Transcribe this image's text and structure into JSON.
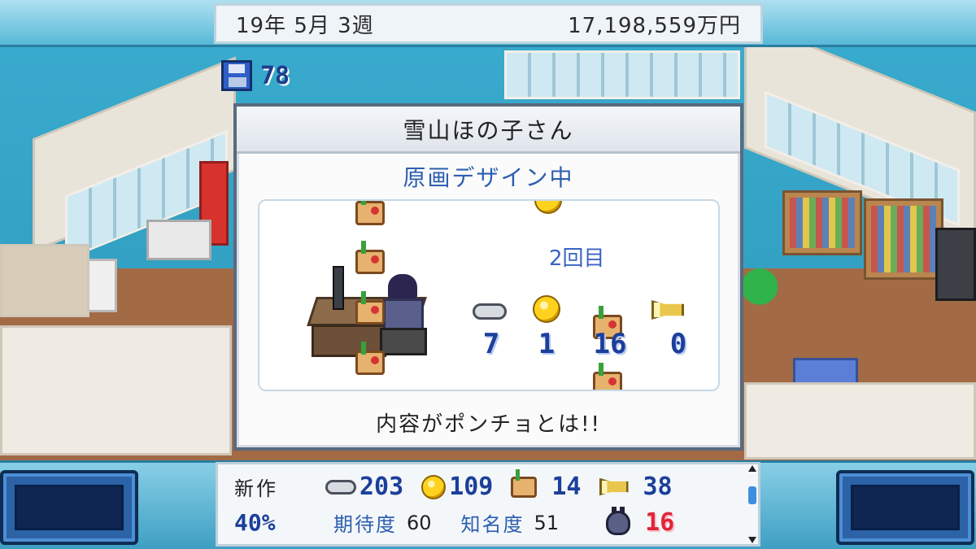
{
  "top_bar": {
    "date": "19年  5月  3週",
    "money": "17,198,559万円"
  },
  "save": {
    "icon": "floppy-disk-icon",
    "count": "78"
  },
  "dialog": {
    "title": "雪山ほの子さん",
    "status": "原画デザイン中",
    "round_text": "2回目",
    "message": "内容がポンチョとは!!",
    "stats": [
      {
        "icon": "gamepad-icon",
        "value": "7"
      },
      {
        "icon": "coin-icon",
        "value": "1"
      },
      {
        "icon": "paint-icon",
        "value": "16"
      },
      {
        "icon": "sound-icon",
        "value": "0"
      }
    ]
  },
  "project": {
    "label": "新作",
    "progress": "40%",
    "stats": [
      {
        "icon": "gamepad-icon",
        "value": "203"
      },
      {
        "icon": "coin-icon",
        "value": "109"
      },
      {
        "icon": "paint-icon",
        "value": "14"
      },
      {
        "icon": "sound-icon",
        "value": "38"
      }
    ],
    "expectation_label": "期待度",
    "expectation_value": "60",
    "fame_label": "知名度",
    "fame_value": "51",
    "bug_icon": "bug-icon",
    "bug_count": "16"
  },
  "colors": {
    "stat_blue": "#1b3f9a",
    "status_blue": "#2d5fb0",
    "bug_red": "#e0253a",
    "sky_blue": "#3aaccf"
  }
}
